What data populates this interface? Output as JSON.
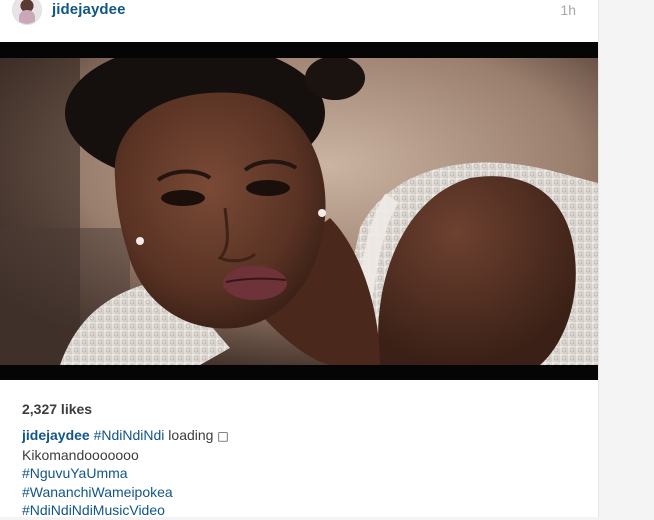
{
  "post": {
    "username": "jidejaydee",
    "time_ago": "1h",
    "avatar_icon": "profile-avatar",
    "media_icon": "video-still-woman-lace-dress",
    "likes": "2,327 likes",
    "caption": {
      "username": "jidejaydee",
      "first_line_hashtag": "#NdiNdiNdi",
      "first_line_text": " loading ",
      "emoji_placeholder": "□",
      "lines": [
        "Kikomandooooooo",
        "#NguvuYaUmma",
        "#WananchiWameipokea",
        "#NdiNdiNdiMusicVideo"
      ]
    }
  },
  "colors": {
    "link": "#125688",
    "text": "#3d3d3d",
    "timestamp": "#a5a7aa",
    "letterbox": "#050505"
  }
}
